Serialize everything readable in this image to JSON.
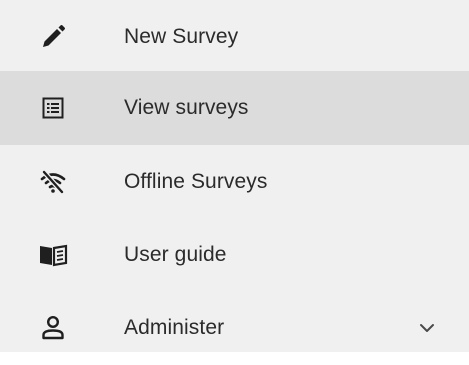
{
  "sidebar": {
    "items": [
      {
        "label": "New Survey",
        "icon": "pencil-icon",
        "active": false
      },
      {
        "label": "View surveys",
        "icon": "list-icon",
        "active": true
      },
      {
        "label": "Offline Surveys",
        "icon": "wifi-off-icon",
        "active": false
      },
      {
        "label": "User guide",
        "icon": "book-icon",
        "active": false
      },
      {
        "label": "Administer",
        "icon": "person-icon",
        "active": false,
        "expandable": true,
        "expand_icon": "chevron-down-icon"
      }
    ]
  },
  "colors": {
    "background": "#f0f0f0",
    "active_background": "#dcdcdc",
    "text": "#2b2b2b",
    "icon": "#1f1f1f"
  }
}
